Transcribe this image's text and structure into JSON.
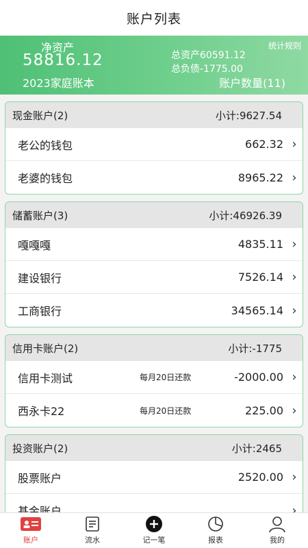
{
  "header": {
    "title": "账户列表"
  },
  "summary": {
    "net_label": "净资产",
    "net_value": "58816.12",
    "book_name": "2023家庭账本",
    "rules_label": "统计规则",
    "total_assets": "总资产60591.12",
    "total_debt": "总负债-1775.00",
    "account_count": "账户数量(11)"
  },
  "groups": [
    {
      "name": "现金账户(2)",
      "subtotal": "小计:9627.54",
      "rows": [
        {
          "name": "老公的钱包",
          "note": "",
          "amount": "662.32"
        },
        {
          "name": "老婆的钱包",
          "note": "",
          "amount": "8965.22"
        }
      ]
    },
    {
      "name": "储蓄账户(3)",
      "subtotal": "小计:46926.39",
      "rows": [
        {
          "name": "嘎嘎嘎",
          "note": "",
          "amount": "4835.11"
        },
        {
          "name": "建设银行",
          "note": "",
          "amount": "7526.14"
        },
        {
          "name": "工商银行",
          "note": "",
          "amount": "34565.14"
        }
      ]
    },
    {
      "name": "信用卡账户(2)",
      "subtotal": "小计:-1775",
      "rows": [
        {
          "name": "信用卡测试",
          "note": "每月20日还款",
          "amount": "-2000.00"
        },
        {
          "name": "西永卡22",
          "note": "每月20日还款",
          "amount": "225.00"
        }
      ]
    },
    {
      "name": "投资账户(2)",
      "subtotal": "小计:2465",
      "rows": [
        {
          "name": "股票账户",
          "note": "",
          "amount": "2520.00"
        },
        {
          "name": "基金账户",
          "note": "",
          "amount": ""
        }
      ]
    }
  ],
  "chevron": "›",
  "tabs": [
    {
      "label": "账户",
      "icon": "account-card-icon",
      "active": true
    },
    {
      "label": "流水",
      "icon": "list-icon",
      "active": false
    },
    {
      "label": "记一笔",
      "icon": "plus-circle-icon",
      "active": false
    },
    {
      "label": "报表",
      "icon": "pie-chart-icon",
      "active": false
    },
    {
      "label": "我的",
      "icon": "user-icon",
      "active": false
    }
  ],
  "colors": {
    "accent_green": "#4fc076",
    "border_green": "#8fd6a2",
    "active_red": "#e24040"
  }
}
